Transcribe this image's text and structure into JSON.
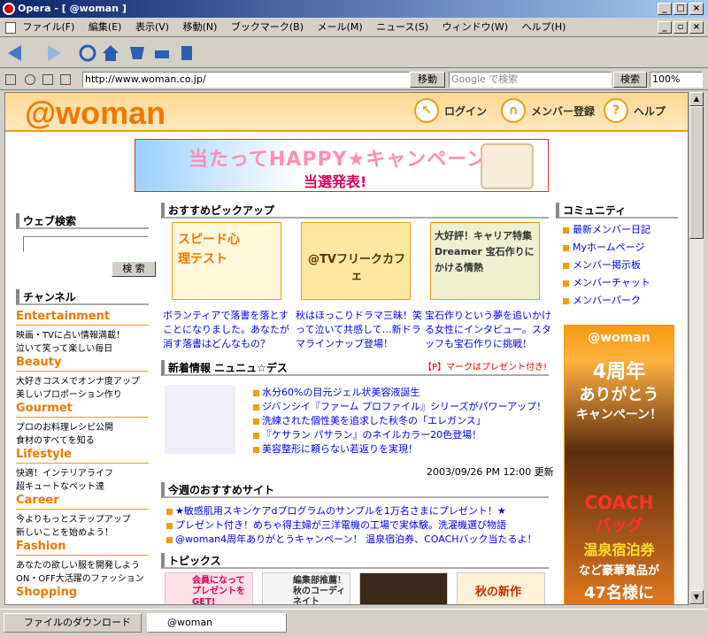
{
  "window": {
    "title": "Opera - [ @woman ]"
  },
  "menu": [
    "ファイル(F)",
    "編集(E)",
    "表示(V)",
    "移動(N)",
    "ブックマーク(B)",
    "メール(M)",
    "ニュース(S)",
    "ウィンドウ(W)",
    "ヘルプ(H)"
  ],
  "address": {
    "url": "http://www.woman.co.jp/",
    "go": "移動",
    "search_placeholder": "Google で検索",
    "search_btn": "検索",
    "zoom": "100%"
  },
  "header": {
    "logo": "@woman",
    "links": [
      "ログイン",
      "メンバー登録",
      "ヘルプ"
    ]
  },
  "campaign": {
    "title": "当たってHAPPY★キャンペーン",
    "subtitle": "当選発表!"
  },
  "left": {
    "search_title": "ウェブ検索",
    "search_btn": "検 索",
    "channel_title": "チャンネル",
    "channels": [
      {
        "name": "Entertainment",
        "subs": [
          "映画・TVに占い情報満載！",
          "泣いて笑って楽しい毎日"
        ]
      },
      {
        "name": "Beauty",
        "subs": [
          "大好きコスメでオンナ度アップ",
          "美しいプロポーション作り"
        ]
      },
      {
        "name": "Gourmet",
        "subs": [
          "プロのお料理レシピ公開",
          "食材のすべてを知る"
        ]
      },
      {
        "name": "Lifestyle",
        "subs": [
          "快適！インテリアライフ",
          "超キュートなペット達"
        ]
      },
      {
        "name": "Career",
        "subs": [
          "今よりもっとステップアップ",
          "新しいことを始めよう！"
        ]
      },
      {
        "name": "Fashion",
        "subs": [
          "あなたの欲しい服を開発しよう",
          "ON・OFF大活躍のファッション"
        ]
      },
      {
        "name": "Shopping",
        "subs": []
      }
    ]
  },
  "pickup": {
    "title": "おすすめピックアップ",
    "items": [
      {
        "img": "スピード心理テスト",
        "text": "ボランティアで落書を落とすことになりました。あなたが消す落書はどんなもの？"
      },
      {
        "img": "@TVフリークカフェ",
        "text": "秋はほっこりドラマ三昧！笑って泣いて共感して…新ドラマラインナップ登場！"
      },
      {
        "img": "大好評！キャリア特集 Dreamer 宝石作りにかける情熱",
        "text": "宝石作りという夢を追いかける女性にインタビュー。スタッフも宝石作りに挑戦！"
      }
    ]
  },
  "news": {
    "title": "新着情報 ニュニュ☆デス",
    "note": "【P】マークはプレゼント付き!",
    "items": [
      "水分60%の目元ジェル状美容液誕生",
      "ジバンシイ『ファーム プロファイル』シリーズがパワーアップ！",
      "洗練された個性美を追求した秋冬の「エレガンス」",
      "『ケサラン パサラン』のネイルカラー20色登場！",
      "美容整形に頼らない若返りを実現！"
    ],
    "date": "2003/09/26 PM 12:00 更新"
  },
  "weekly": {
    "title": "今週のおすすめサイト",
    "items": [
      "★敏感肌用スキンケアdプログラムのサンプルを1万名さまにプレゼント！★",
      "プレゼント付き！めちゃ得主婦が三洋電機の工場で実体験。洗濯機選び物語",
      "@woman4周年ありがとうキャンペーン！ 温泉宿泊券、COACHバック当たるよ！"
    ]
  },
  "topics": {
    "title": "トピックス",
    "imgs": [
      "会員になってプレゼントをGET!",
      "編集部推薦！秋のコーディネイト",
      "",
      "秋の新作"
    ]
  },
  "community": {
    "title": "コミュニティ",
    "items": [
      "最新メンバー日記",
      "Myホームページ",
      "メンバー掲示板",
      "メンバーチャット",
      "メンバーパーク"
    ]
  },
  "ad": {
    "logo": "@woman",
    "l1": "4周年",
    "l2": "ありがとう",
    "l3": "キャンペーン！",
    "l4": "COACH",
    "l5": "バッグ",
    "l6": "温泉宿泊券",
    "l7": "など豪華賞品が",
    "l8": "47名様に"
  },
  "status": {
    "downloads": "ファイルのダウンロード",
    "tab": "@woman"
  }
}
